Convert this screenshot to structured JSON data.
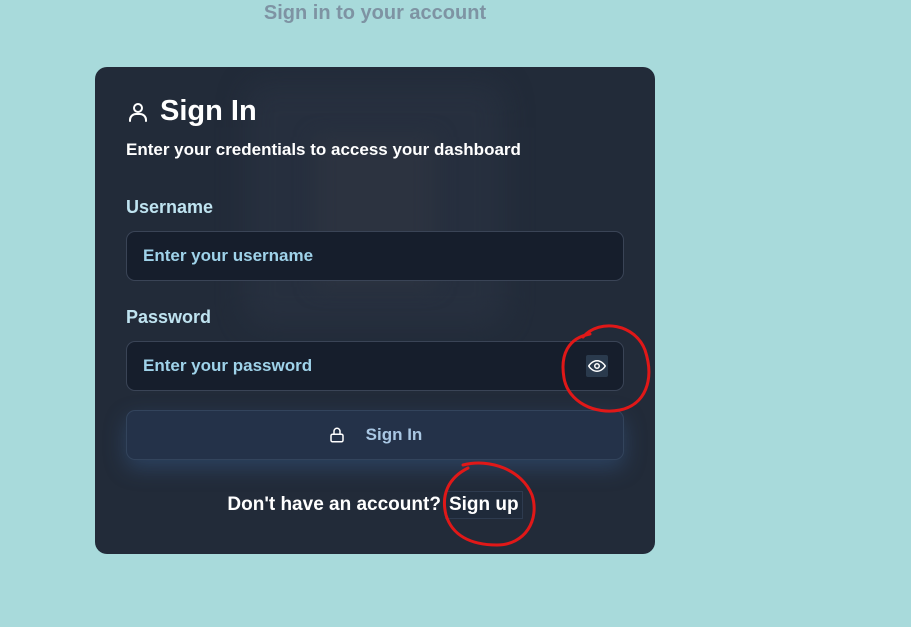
{
  "page": {
    "subtitle": "Sign in to your account"
  },
  "card": {
    "title": "Sign In",
    "description": "Enter your credentials to access your dashboard",
    "username": {
      "label": "Username",
      "placeholder": "Enter your username",
      "value": ""
    },
    "password": {
      "label": "Password",
      "placeholder": "Enter your password",
      "value": ""
    },
    "submit_label": "Sign In",
    "footer_text": "Don't have an account?",
    "signup_label": "Sign up"
  },
  "icons": {
    "title": "user-icon",
    "toggle": "eye-icon",
    "submit": "lock-icon"
  },
  "colors": {
    "background": "#a8dadb",
    "card": "#222b39",
    "input": "#161e2c",
    "label": "#bfe3f0",
    "placeholder": "#9fd3ea",
    "button": "#243249",
    "annotation": "#e01818"
  }
}
